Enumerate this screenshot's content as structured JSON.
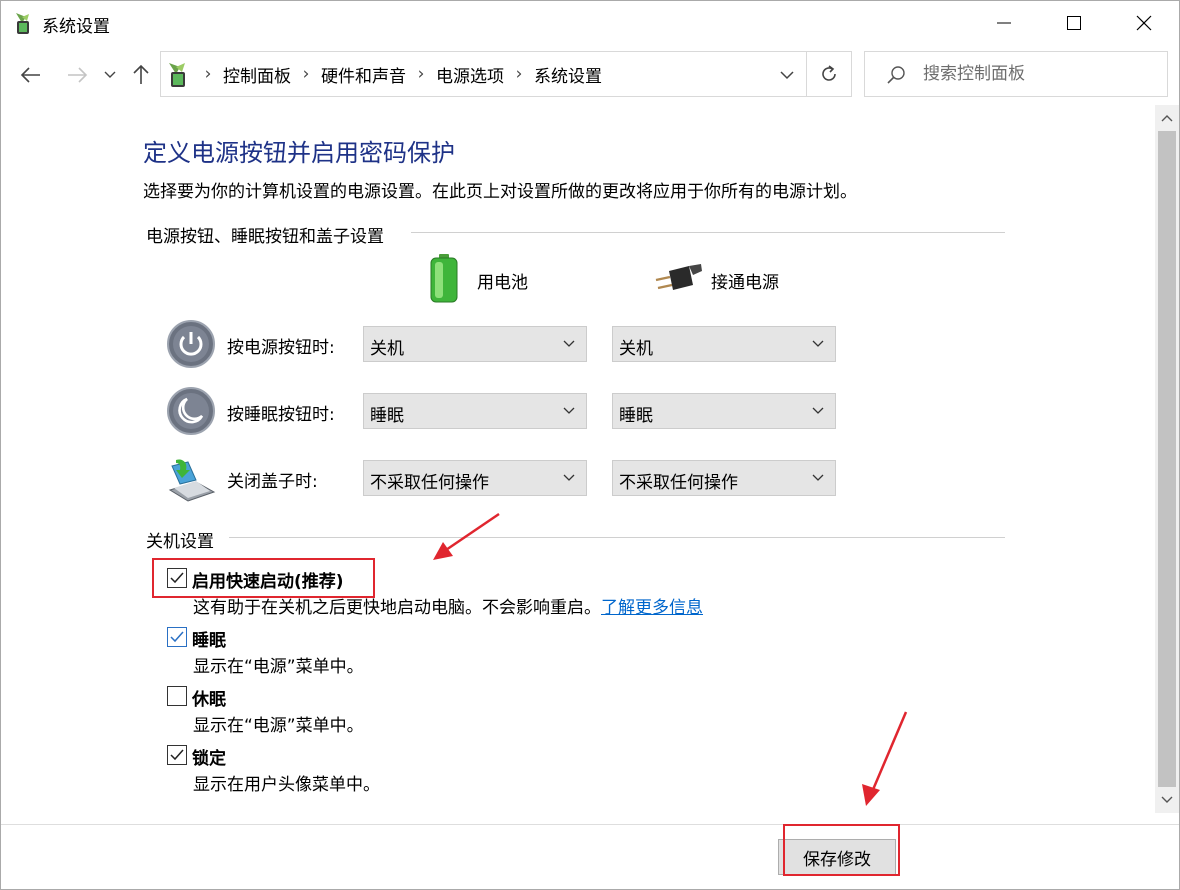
{
  "window": {
    "title": "系统设置",
    "minimize_icon": "minimize-icon",
    "maximize_icon": "maximize-icon",
    "close_icon": "close-icon"
  },
  "nav": {
    "back_icon": "arrow-left-icon",
    "forward_icon": "arrow-right-icon",
    "recent_icon": "chevron-down-icon",
    "up_icon": "arrow-up-icon",
    "breadcrumbs": [
      "控制面板",
      "硬件和声音",
      "电源选项",
      "系统设置"
    ],
    "search_placeholder": "搜索控制面板"
  },
  "content": {
    "heading": "定义电源按钮并启用密码保护",
    "subtitle": "选择要为你的计算机设置的电源设置。在此页上对设置所做的更改将应用于你所有的电源计划。",
    "power_group_title": "电源按钮、睡眠按钮和盖子设置",
    "columns": {
      "battery": "用电池",
      "plugged_in": "接通电源"
    },
    "rows": [
      {
        "label": "按电源按钮时:",
        "battery": "关机",
        "plugged_in": "关机",
        "icon": "power-button-icon"
      },
      {
        "label": "按睡眠按钮时:",
        "battery": "睡眠",
        "plugged_in": "睡眠",
        "icon": "sleep-button-icon"
      },
      {
        "label": "关闭盖子时:",
        "battery": "不采取任何操作",
        "plugged_in": "不采取任何操作",
        "icon": "laptop-lid-icon"
      }
    ],
    "shutdown_group_title": "关机设置",
    "shutdown_options": [
      {
        "label": "启用快速启动(推荐)",
        "checked": true,
        "desc": "这有助于在关机之后更快地启动电脑。不会影响重启。",
        "link": "了解更多信息"
      },
      {
        "label": "睡眠",
        "checked": true,
        "desc": "显示在“电源”菜单中。"
      },
      {
        "label": "休眠",
        "checked": false,
        "desc": "显示在“电源”菜单中。"
      },
      {
        "label": "锁定",
        "checked": true,
        "desc": "显示在用户头像菜单中。"
      }
    ]
  },
  "footer": {
    "save_label": "保存修改"
  },
  "colors": {
    "heading": "#1e3287",
    "link": "#0066cc",
    "annotation_red": "#e0262f",
    "checkbox_blue": "#2a70c4"
  }
}
